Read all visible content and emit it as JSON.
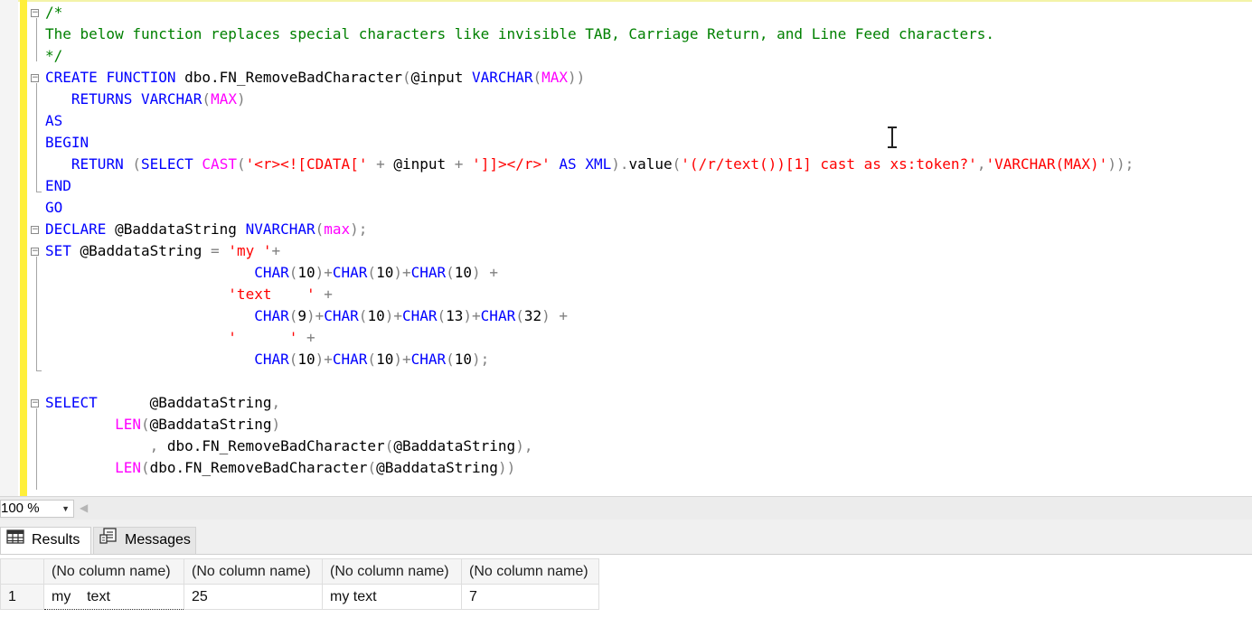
{
  "editor": {
    "lines": [
      {
        "line": 1,
        "fold": "minus",
        "tokens": [
          {
            "t": "/*",
            "c": "cm"
          }
        ]
      },
      {
        "line": 2,
        "tokens": [
          {
            "t": "The below function replaces special characters like invisible TAB, Carriage Return, and Line Feed characters.",
            "c": "cm"
          }
        ]
      },
      {
        "line": 3,
        "tokens": [
          {
            "t": "*/",
            "c": "cm"
          }
        ]
      },
      {
        "line": 4,
        "fold": "minus",
        "tokens": [
          {
            "t": "CREATE",
            "c": "kw"
          },
          {
            "t": " "
          },
          {
            "t": "FUNCTION",
            "c": "kw"
          },
          {
            "t": " dbo.FN_RemoveBadCharacter"
          },
          {
            "t": "(",
            "c": "gr"
          },
          {
            "t": "@input "
          },
          {
            "t": "VARCHAR",
            "c": "kw"
          },
          {
            "t": "(",
            "c": "gr"
          },
          {
            "t": "MAX",
            "c": "fn"
          },
          {
            "t": "))",
            "c": "gr"
          }
        ]
      },
      {
        "line": 5,
        "tokens": [
          {
            "t": "   "
          },
          {
            "t": "RETURNS",
            "c": "kw"
          },
          {
            "t": " "
          },
          {
            "t": "VARCHAR",
            "c": "kw"
          },
          {
            "t": "(",
            "c": "gr"
          },
          {
            "t": "MAX",
            "c": "fn"
          },
          {
            "t": ")",
            "c": "gr"
          }
        ]
      },
      {
        "line": 6,
        "tokens": [
          {
            "t": "AS",
            "c": "kw"
          }
        ]
      },
      {
        "line": 7,
        "tokens": [
          {
            "t": "BEGIN",
            "c": "kw"
          }
        ]
      },
      {
        "line": 8,
        "tokens": [
          {
            "t": "   "
          },
          {
            "t": "RETURN",
            "c": "kw"
          },
          {
            "t": " "
          },
          {
            "t": "(",
            "c": "gr"
          },
          {
            "t": "SELECT",
            "c": "kw"
          },
          {
            "t": " "
          },
          {
            "t": "CAST",
            "c": "fn"
          },
          {
            "t": "(",
            "c": "gr"
          },
          {
            "t": "'<r><![CDATA['",
            "c": "st"
          },
          {
            "t": " + ",
            "c": "gr"
          },
          {
            "t": "@input"
          },
          {
            "t": " + ",
            "c": "gr"
          },
          {
            "t": "']]></r>'",
            "c": "st"
          },
          {
            "t": " "
          },
          {
            "t": "AS",
            "c": "kw"
          },
          {
            "t": " "
          },
          {
            "t": "XML",
            "c": "kw"
          },
          {
            "t": ").",
            "c": "gr"
          },
          {
            "t": "value"
          },
          {
            "t": "(",
            "c": "gr"
          },
          {
            "t": "'(/r/text())[1] cast as xs:token?'",
            "c": "st"
          },
          {
            "t": ",",
            "c": "gr"
          },
          {
            "t": "'VARCHAR(MAX)'",
            "c": "st"
          },
          {
            "t": "));",
            "c": "gr"
          }
        ]
      },
      {
        "line": 9,
        "tokens": [
          {
            "t": "END",
            "c": "kw"
          }
        ]
      },
      {
        "line": 10,
        "tokens": [
          {
            "t": "GO",
            "c": "kw"
          }
        ]
      },
      {
        "line": 11,
        "fold": "minus",
        "tokens": [
          {
            "t": "DECLARE",
            "c": "kw"
          },
          {
            "t": " @BaddataString "
          },
          {
            "t": "NVARCHAR",
            "c": "kw"
          },
          {
            "t": "(",
            "c": "gr"
          },
          {
            "t": "max",
            "c": "fn"
          },
          {
            "t": ");",
            "c": "gr"
          }
        ]
      },
      {
        "line": 12,
        "fold": "minus",
        "tokens": [
          {
            "t": "SET",
            "c": "kw"
          },
          {
            "t": " @BaddataString "
          },
          {
            "t": "=",
            "c": "gr"
          },
          {
            "t": " "
          },
          {
            "t": "'my '",
            "c": "st"
          },
          {
            "t": "+",
            "c": "gr"
          }
        ]
      },
      {
        "line": 13,
        "tokens": [
          {
            "t": "                        "
          },
          {
            "t": "CHAR",
            "c": "kw"
          },
          {
            "t": "(",
            "c": "gr"
          },
          {
            "t": "10"
          },
          {
            "t": ")+",
            "c": "gr"
          },
          {
            "t": "CHAR",
            "c": "kw"
          },
          {
            "t": "(",
            "c": "gr"
          },
          {
            "t": "10"
          },
          {
            "t": ")+",
            "c": "gr"
          },
          {
            "t": "CHAR",
            "c": "kw"
          },
          {
            "t": "(",
            "c": "gr"
          },
          {
            "t": "10"
          },
          {
            "t": ")",
            "c": "gr"
          },
          {
            "t": " "
          },
          {
            "t": "+",
            "c": "gr"
          }
        ]
      },
      {
        "line": 14,
        "tokens": [
          {
            "t": "                     "
          },
          {
            "t": "'text    '",
            "c": "st"
          },
          {
            "t": " "
          },
          {
            "t": "+",
            "c": "gr"
          }
        ]
      },
      {
        "line": 15,
        "tokens": [
          {
            "t": "                        "
          },
          {
            "t": "CHAR",
            "c": "kw"
          },
          {
            "t": "(",
            "c": "gr"
          },
          {
            "t": "9"
          },
          {
            "t": ")+",
            "c": "gr"
          },
          {
            "t": "CHAR",
            "c": "kw"
          },
          {
            "t": "(",
            "c": "gr"
          },
          {
            "t": "10"
          },
          {
            "t": ")+",
            "c": "gr"
          },
          {
            "t": "CHAR",
            "c": "kw"
          },
          {
            "t": "(",
            "c": "gr"
          },
          {
            "t": "13"
          },
          {
            "t": ")+",
            "c": "gr"
          },
          {
            "t": "CHAR",
            "c": "kw"
          },
          {
            "t": "(",
            "c": "gr"
          },
          {
            "t": "32"
          },
          {
            "t": ")",
            "c": "gr"
          },
          {
            "t": " "
          },
          {
            "t": "+",
            "c": "gr"
          }
        ]
      },
      {
        "line": 16,
        "tokens": [
          {
            "t": "                     "
          },
          {
            "t": "'      '",
            "c": "st"
          },
          {
            "t": " "
          },
          {
            "t": "+",
            "c": "gr"
          }
        ]
      },
      {
        "line": 17,
        "tokens": [
          {
            "t": "                        "
          },
          {
            "t": "CHAR",
            "c": "kw"
          },
          {
            "t": "(",
            "c": "gr"
          },
          {
            "t": "10"
          },
          {
            "t": ")+",
            "c": "gr"
          },
          {
            "t": "CHAR",
            "c": "kw"
          },
          {
            "t": "(",
            "c": "gr"
          },
          {
            "t": "10"
          },
          {
            "t": ")+",
            "c": "gr"
          },
          {
            "t": "CHAR",
            "c": "kw"
          },
          {
            "t": "(",
            "c": "gr"
          },
          {
            "t": "10"
          },
          {
            "t": ");",
            "c": "gr"
          }
        ]
      },
      {
        "line": 18,
        "tokens": []
      },
      {
        "line": 19,
        "fold": "minus",
        "tokens": [
          {
            "t": "SELECT",
            "c": "kw"
          },
          {
            "t": "      @BaddataString"
          },
          {
            "t": ",",
            "c": "gr"
          }
        ]
      },
      {
        "line": 20,
        "tokens": [
          {
            "t": "        "
          },
          {
            "t": "LEN",
            "c": "fn"
          },
          {
            "t": "(",
            "c": "gr"
          },
          {
            "t": "@BaddataString"
          },
          {
            "t": ")",
            "c": "gr"
          }
        ]
      },
      {
        "line": 21,
        "tokens": [
          {
            "t": "            "
          },
          {
            "t": ", ",
            "c": "gr"
          },
          {
            "t": "dbo.FN_RemoveBadCharacter"
          },
          {
            "t": "(",
            "c": "gr"
          },
          {
            "t": "@BaddataString"
          },
          {
            "t": "),",
            "c": "gr"
          }
        ]
      },
      {
        "line": 22,
        "tokens": [
          {
            "t": "        "
          },
          {
            "t": "LEN",
            "c": "fn"
          },
          {
            "t": "(",
            "c": "gr"
          },
          {
            "t": "dbo.FN_RemoveBadCharacter"
          },
          {
            "t": "(",
            "c": "gr"
          },
          {
            "t": "@BaddataString"
          },
          {
            "t": "))",
            "c": "gr"
          }
        ]
      }
    ],
    "colors": {
      "keyword": "#0000ff",
      "function": "#ff00ff",
      "comment": "#008000",
      "string": "#ff0000",
      "operator": "#808080"
    }
  },
  "zoom": {
    "value": "100 %",
    "dropdown_icon": "chevron-down-icon"
  },
  "results_tabs": {
    "results_label": "Results",
    "messages_label": "Messages",
    "results_icon": "grid-icon",
    "messages_icon": "messages-icon"
  },
  "grid": {
    "headers": [
      "(No column name)",
      "(No column name)",
      "(No column name)",
      "(No column name)"
    ],
    "rows": [
      {
        "num": "1",
        "cells": [
          "my    text",
          "25",
          "my text",
          "7"
        ]
      }
    ]
  }
}
